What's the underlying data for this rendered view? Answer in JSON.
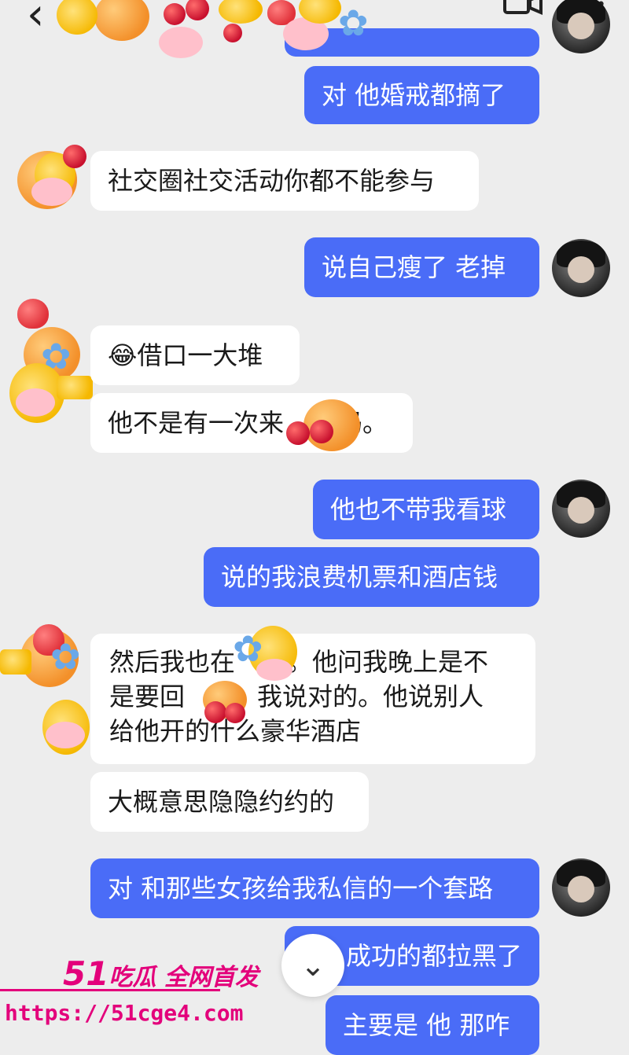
{
  "header": {
    "back_icon": "chevron-left-icon",
    "video_icon": "video-camera-icon",
    "more_icon": "more-dots-icon",
    "back_glyph": "‹",
    "more_glyph": "•••"
  },
  "messages": [
    {
      "side": "out",
      "text": "对 他婚戒都摘了"
    },
    {
      "side": "in",
      "text": "社交圈社交活动你都不能参与"
    },
    {
      "side": "out",
      "text": "说自己瘦了 老掉"
    },
    {
      "side": "in",
      "text": "借口一大堆",
      "emoji": "😂"
    },
    {
      "side": "in",
      "text": "他不是有一次来",
      "tail": "吗。"
    },
    {
      "side": "out",
      "text": "他也不带我看球"
    },
    {
      "side": "out",
      "text": "说的我浪费机票和酒店钱"
    },
    {
      "side": "in",
      "line1": "然后我也在",
      "line1b": "。他问我晚上是不",
      "line2": "是要回",
      "line2b": "。我说对的。他说别人",
      "line3": "给他开的什么豪华酒店"
    },
    {
      "side": "in",
      "text": "大概意思隐隐约约的"
    },
    {
      "side": "out",
      "text": "对 和那些女孩给我私信的一个套路"
    },
    {
      "side": "out",
      "text": "成功的都拉黑了"
    },
    {
      "side": "out",
      "text": "主要是 他 那咋"
    }
  ],
  "scroll_down_glyph": "⌄",
  "watermark": {
    "number": "51",
    "brand": "吃瓜 全网首发",
    "url": "https://51cge4.com"
  },
  "colors": {
    "outgoing": "#4a6cf7",
    "incoming": "#ffffff",
    "background": "#ededed",
    "watermark": "#e3007b"
  }
}
